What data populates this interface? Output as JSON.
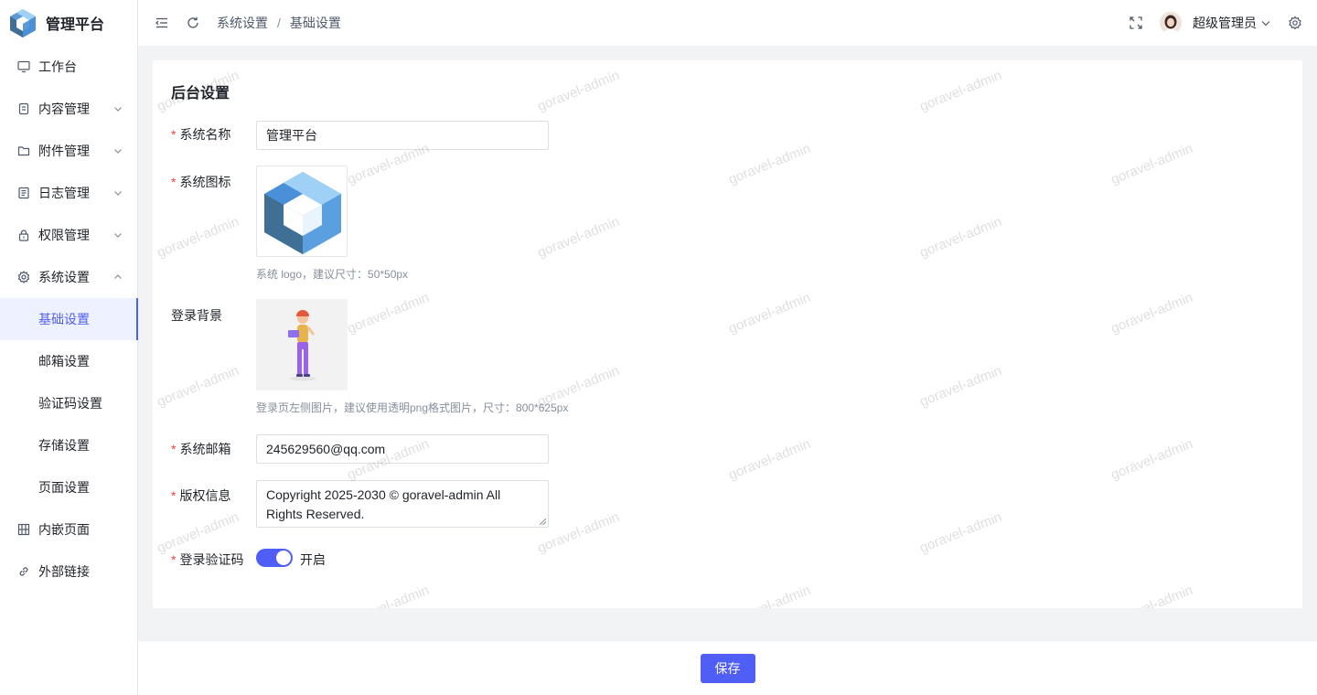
{
  "brand": {
    "title": "管理平台"
  },
  "sidebar": {
    "items": [
      {
        "label": "工作台",
        "icon": "monitor-icon"
      },
      {
        "label": "内容管理",
        "icon": "document-icon"
      },
      {
        "label": "附件管理",
        "icon": "folder-icon"
      },
      {
        "label": "日志管理",
        "icon": "log-icon"
      },
      {
        "label": "权限管理",
        "icon": "lock-icon"
      },
      {
        "label": "系统设置",
        "icon": "gear-icon"
      },
      {
        "label": "基础设置"
      },
      {
        "label": "邮箱设置"
      },
      {
        "label": "验证码设置"
      },
      {
        "label": "存储设置"
      },
      {
        "label": "页面设置"
      },
      {
        "label": "内嵌页面",
        "icon": "grid-icon"
      },
      {
        "label": "外部链接",
        "icon": "link-icon"
      }
    ]
  },
  "header": {
    "breadcrumb": [
      "系统设置",
      "基础设置"
    ],
    "separator": "/",
    "username": "超级管理员"
  },
  "form": {
    "title": "后台设置",
    "required_mark": "*",
    "system_name_label": "系统名称",
    "system_name_value": "管理平台",
    "system_icon_label": "系统图标",
    "system_icon_hint": "系统 logo，建议尺寸：50*50px",
    "login_bg_label": "登录背景",
    "login_bg_hint": "登录页左侧图片，建议使用透明png格式图片，尺寸：800*625px",
    "email_label": "系统邮箱",
    "email_value": "245629560@qq.com",
    "copyright_label": "版权信息",
    "copyright_value": "Copyright 2025-2030 © goravel-admin All Rights Reserved.",
    "captcha_label": "登录验证码",
    "captcha_enabled": true,
    "captcha_state": "开启"
  },
  "watermark": "goravel-admin",
  "footer": {
    "save_label": "保存"
  },
  "colors": {
    "accent": "#4f5ef5",
    "required": "#f53f3f"
  }
}
